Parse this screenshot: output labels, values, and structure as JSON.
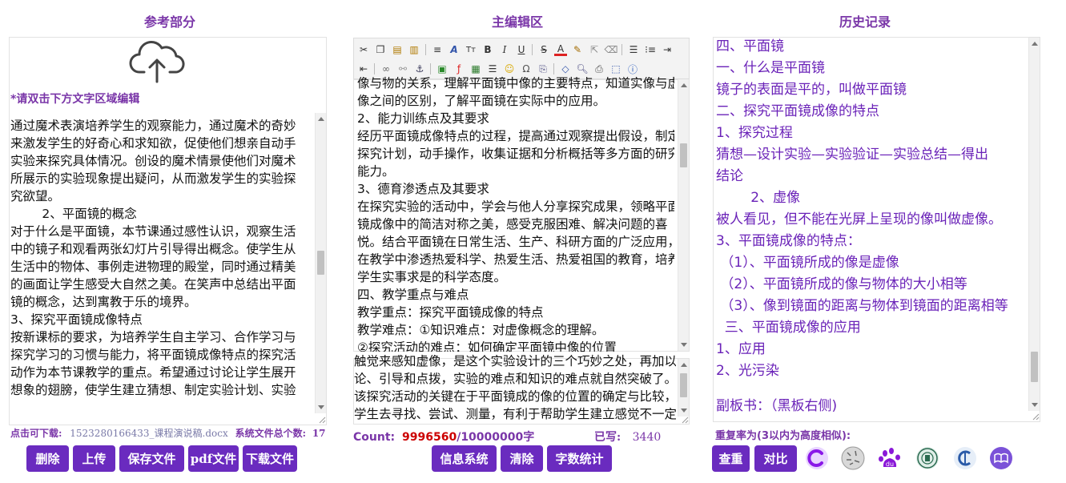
{
  "columns": {
    "reference_title": "参考部分",
    "editor_title": "主编辑区",
    "history_title": "历史记录"
  },
  "reference": {
    "hint": "*请双击下方文字区域编辑",
    "upload_icon": "cloud-upload-icon",
    "lines": [
      "通过魔术表演培养学生的观察能力，通过魔术的奇妙",
      "来激发学生的好奇心和求知欲，促使他们想亲自动手",
      "实验来探究具体情况。创设的魔术情景使他们对魔术",
      "所展示的实验现象提出疑问，从而激发学生的实验探",
      "究欲望。",
      "        2、平面镜的概念",
      "对于什么是平面镜，本节课通过感性认识，观察生活",
      "中的镜子和观看两张幻灯片引导得出概念。使学生从",
      "生活中的物体、事例走进物理的殿堂，同时通过精美",
      "的画面让学生感受大自然之美。在笑声中总结出平面",
      "镜的概念，达到寓教于乐的境界。",
      "3、探究平面镜成像特点",
      "按新课标的要求，为培养学生自主学习、合作学习与",
      "探究学习的习惯与能力，将平面镜成像特点的探究活",
      "动作为本节课教学的重点。希望通过讨论让学生展开",
      "想象的翅膀，使学生建立猜想、制定实验计划、实验"
    ],
    "download_label": "点击可下载:",
    "download_file": "1523280166433_课程演说稿.docx",
    "file_count_label": "系统文件总个数:",
    "file_count": "17",
    "buttons": [
      "删除",
      "上传",
      "保存文件",
      "pdf文件",
      "下载文件"
    ]
  },
  "editor": {
    "lines": [
      "像与物的关系，理解平面镜中像的主要特点，知道实像与虚",
      "像之间的区别，了解平面镜在实际中的应用。",
      "2、能力训练点及其要求",
      "经历平面镜成像特点的过程，提高通过观察提出假设，制定",
      "探究计划，动手操作，收集证据和分析概括等多方面的研究",
      "能力。",
      "3、德育渗透点及其要求",
      "在探究实验的活动中，学会与他人分享探究成果，领略平面",
      "镜成像中的简洁对称之美，感受克服困难、解决问题的喜",
      "悦。结合平面镜在日常生活、生产、科研方面的广泛应用，",
      "在教学中渗透热爱科学、热爱生活、热爱祖国的教育，培养",
      "学生实事求是的科学态度。",
      "四、教学重点与难点",
      "教学重点：探究平面镜成像的特点",
      "教学难点：①知识难点：对虚像概念的理解。",
      "②探究活动的难点：如何确定平面镜中像的位置"
    ],
    "lower_lines": [
      "触觉来感知虚像，是这个实验设计的三个巧妙之处，再加以讨",
      "论、引导和点拨，实验的难点和知识的难点就自然突破了。",
      "该探究活动的关键在于平面镜成的像的位置的确定与比较，让",
      "学生去寻找、尝试、测量，有利于帮助学生建立感觉不一定可"
    ],
    "count_label": "Count:",
    "count_value": "9996560",
    "count_max": "/10000000字",
    "written_label": "已写:",
    "written_value": "3440",
    "buttons": [
      "信息系统",
      "清除",
      "字数统计"
    ]
  },
  "history": {
    "lines": [
      "四、平面镜",
      "一、什么是平面镜",
      "镜子的表面是平的，叫做平面镜",
      "二、探究平面镜成像的特点",
      "1、探究过程",
      "猜想—设计实验—实验验证—实验总结—得出",
      "结论",
      "        2、虚像",
      "被人看见，但不能在光屏上呈现的像叫做虚像。",
      "3、平面镜成像的特点：",
      " （1）、平面镜所成的像是虚像",
      " （2）、平面镜所成的像与物体的大小相等",
      " （3）、像到镜面的距离与物体到镜面的距离相等",
      "  三、平面镜成像的应用",
      "1、应用",
      "2、光污染",
      "",
      "副板书：（黑板右侧)"
    ],
    "repeat_label": "重复率为(3以内为高度相似):",
    "buttons": [
      "查重",
      "对比"
    ],
    "logos": [
      "circle-c-logo-icon",
      "wikipedia-globe-icon",
      "baidu-paw-icon",
      "university-seal-icon",
      "cnki-logo-icon",
      "book-logo-icon"
    ]
  },
  "colors": {
    "purple": "#6a2bbf",
    "title_purple": "#7a36a8",
    "history_text": "#6a22b8",
    "red": "#cc0000"
  }
}
